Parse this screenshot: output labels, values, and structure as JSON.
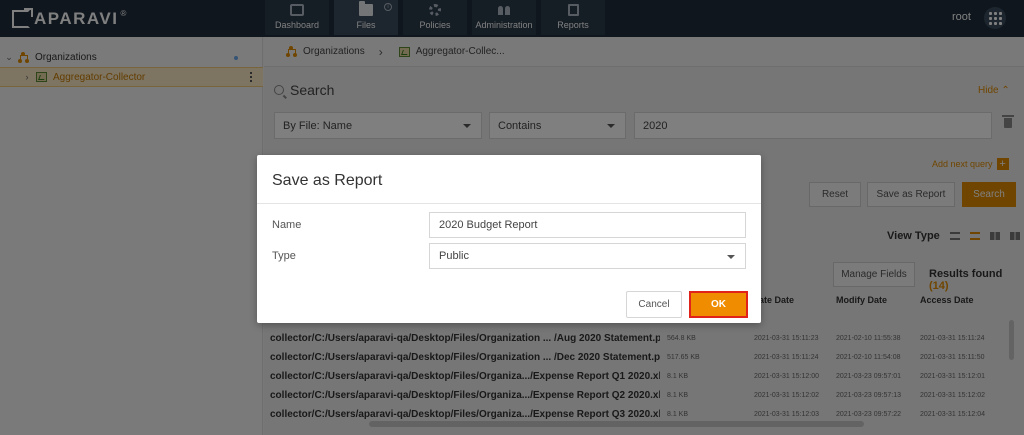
{
  "app": {
    "logo_text": "APARAVI",
    "logo_mark": "®",
    "user": "root",
    "nav": [
      {
        "label": "Dashboard",
        "icon": "dashboard-icon"
      },
      {
        "label": "Files",
        "icon": "folder-icon"
      },
      {
        "label": "Policies",
        "icon": "gear-icon"
      },
      {
        "label": "Administration",
        "icon": "people-icon"
      },
      {
        "label": "Reports",
        "icon": "report-icon"
      }
    ]
  },
  "sidebar": {
    "root": "Organizations",
    "child": "Aggregator-Collector"
  },
  "breadcrumb": {
    "root": "Organizations",
    "current": "Aggregator-Collec..."
  },
  "search": {
    "title": "Search",
    "hide": "Hide",
    "field": "By File: Name",
    "operator": "Contains",
    "value": "2020",
    "add_query": "Add next query",
    "reset": "Reset",
    "save_as_report": "Save as Report",
    "search": "Search"
  },
  "results": {
    "view_type": "View Type",
    "manage_fields": "Manage Fields",
    "results_found": "Results found",
    "count": "(14)",
    "columns": {
      "create": "eate Date",
      "modify": "Modify Date",
      "access": "Access Date"
    },
    "rows": [
      {
        "path": "collector/C:/Users/aparavi-qa/Desktop/Files/Organization ...  /Aug 2020 Statement.pdf",
        "size": "564.8 KB",
        "create": "2021-03-31 15:11:23",
        "modify": "2021-02-10 11:55:38",
        "access": "2021-03-31 15:11:24"
      },
      {
        "path": "collector/C:/Users/aparavi-qa/Desktop/Files/Organization ...  /Dec 2020 Statement.pdf",
        "size": "517.65 KB",
        "create": "2021-03-31 15:11:24",
        "modify": "2021-02-10 11:54:08",
        "access": "2021-03-31 15:11:50"
      },
      {
        "path": "collector/C:/Users/aparavi-qa/Desktop/Files/Organiza.../Expense Report Q1 2020.xlsx",
        "size": "8.1 KB",
        "create": "2021-03-31 15:12:00",
        "modify": "2021-03-23 09:57:01",
        "access": "2021-03-31 15:12:01"
      },
      {
        "path": "collector/C:/Users/aparavi-qa/Desktop/Files/Organiza.../Expense Report Q2 2020.xlsx",
        "size": "8.1 KB",
        "create": "2021-03-31 15:12:02",
        "modify": "2021-03-23 09:57:13",
        "access": "2021-03-31 15:12:02"
      },
      {
        "path": "collector/C:/Users/aparavi-qa/Desktop/Files/Organiza.../Expense Report Q3 2020.xlsx",
        "size": "8.1 KB",
        "create": "2021-03-31 15:12:03",
        "modify": "2021-03-23 09:57:22",
        "access": "2021-03-31 15:12:04"
      }
    ]
  },
  "modal": {
    "title": "Save as Report",
    "name_label": "Name",
    "name_value": "2020 Budget Report",
    "type_label": "Type",
    "type_value": "Public",
    "cancel": "Cancel",
    "ok": "OK"
  }
}
